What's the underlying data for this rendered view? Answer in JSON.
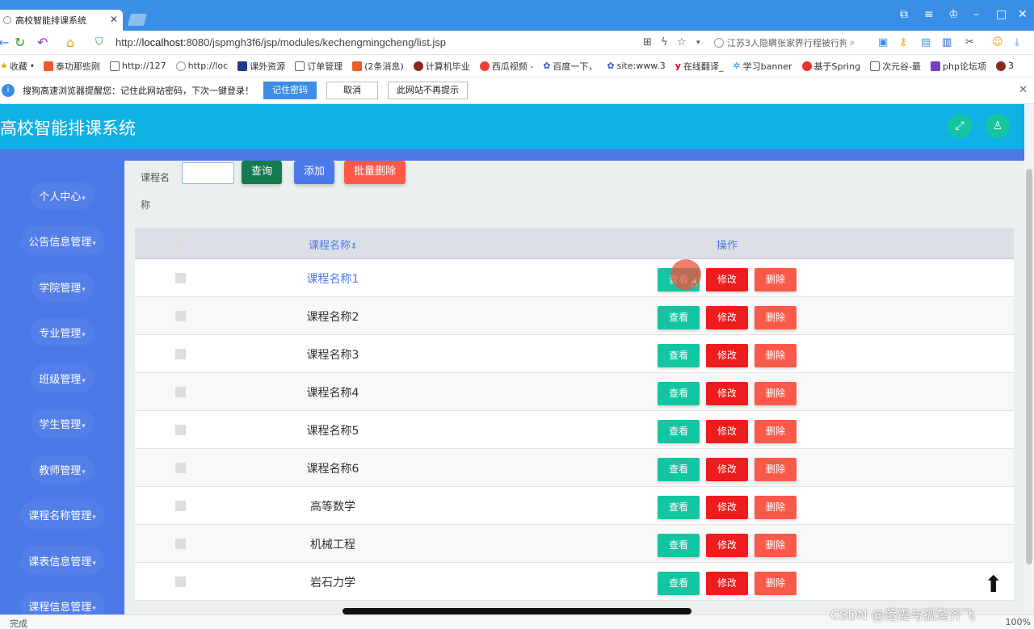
{
  "browser": {
    "tab_title": "高校智能排课系统",
    "url_scheme": "http://",
    "url_host": "localhost",
    "url_rest": ":8080/jspmgh3f6/jsp/modules/kechengmingcheng/list.jsp",
    "search_text": "江苏3人隐瞒张家界行程被行拘",
    "bookmarks": [
      "收藏",
      "泰功那些刚",
      "http://127",
      "http://loc",
      "课外资源",
      "订单管理",
      "(2条消息)",
      "计算机毕业",
      "西瓜视频 -",
      "百度一下，",
      "site:www.3",
      "在线翻译_",
      "学习banner",
      "基于Spring",
      "次元谷-最",
      "php论坛项",
      "3"
    ],
    "password_prompt": "搜狗高速浏览器提醒您：记住此网站密码，下次一键登录！",
    "pw_remember": "记住密码",
    "pw_cancel": "取消",
    "pw_never": "此网站不再提示",
    "status_text": "完成",
    "zoom": "100%"
  },
  "app": {
    "title": "高校智能排课系统"
  },
  "sidebar": {
    "items": [
      {
        "label": "个人中心"
      },
      {
        "label": "公告信息管理"
      },
      {
        "label": "学院管理"
      },
      {
        "label": "专业管理"
      },
      {
        "label": "班级管理"
      },
      {
        "label": "学生管理"
      },
      {
        "label": "教师管理"
      },
      {
        "label": "课程名称管理"
      },
      {
        "label": "课表信息管理"
      },
      {
        "label": "课程信息管理"
      }
    ]
  },
  "toolbar": {
    "search_label": "课程名称",
    "query": "查询",
    "add": "添加",
    "batch_delete": "批量删除"
  },
  "table": {
    "col_name": "课程名称",
    "col_actions": "操作",
    "view": "查看",
    "edit": "修改",
    "delete": "删除",
    "rows": [
      {
        "name": "课程名称1"
      },
      {
        "name": "课程名称2"
      },
      {
        "name": "课程名称3"
      },
      {
        "name": "课程名称4"
      },
      {
        "name": "课程名称5"
      },
      {
        "name": "课程名称6"
      },
      {
        "name": "高等数学"
      },
      {
        "name": "机械工程"
      },
      {
        "name": "岩石力学"
      }
    ]
  },
  "watermark": "CSDN @落霞与孤鹜齐飞"
}
